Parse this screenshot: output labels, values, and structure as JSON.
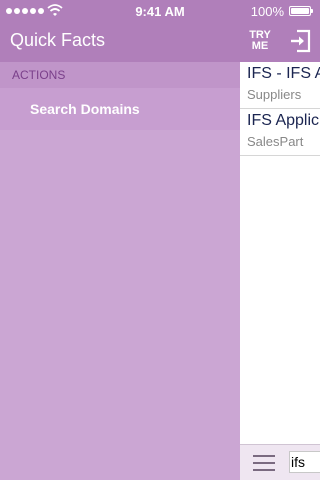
{
  "status_bar": {
    "time": "9:41 AM",
    "battery": "100%",
    "icons": [
      "signal-dots-icon",
      "wifi-icon",
      "battery-icon"
    ]
  },
  "nav": {
    "title": "Quick Facts",
    "try_me_line1": "TRY",
    "try_me_line2": "ME",
    "logout_icon": "logout-icon"
  },
  "side_menu": {
    "section_header": "ACTIONS",
    "items": [
      {
        "label": "Search Domains"
      }
    ]
  },
  "results": [
    {
      "title": "IFS - IFS A",
      "subtitle": "Suppliers"
    },
    {
      "title": "IFS Applic",
      "subtitle": "SalesPart"
    }
  ],
  "bottom_bar": {
    "menu_icon": "hamburger-menu-icon",
    "search_value": "ifs"
  },
  "colors": {
    "nav_background": "#b07fba",
    "menu_background": "#cba6d3",
    "section_text": "#7a3f8a",
    "result_title": "#1a2450"
  }
}
